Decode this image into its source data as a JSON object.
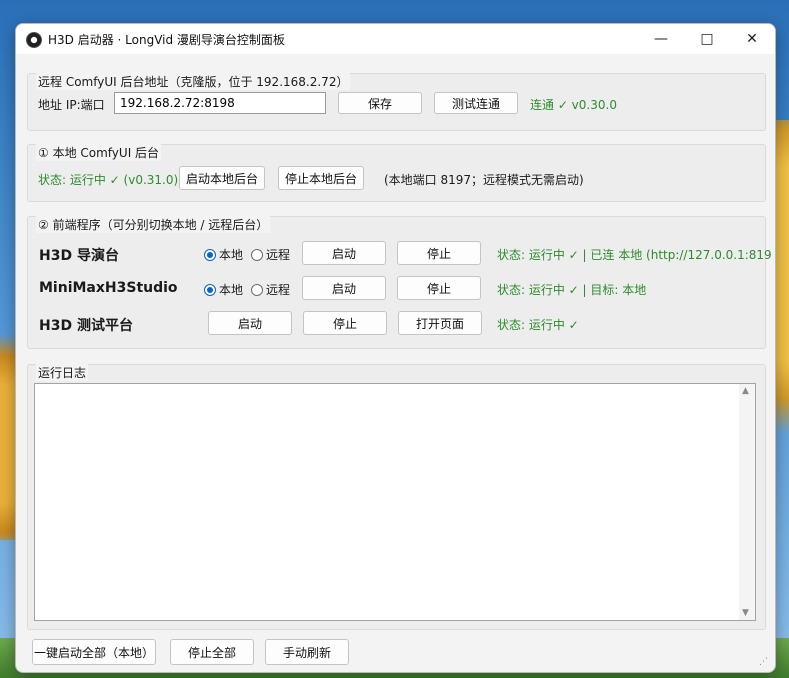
{
  "window": {
    "title": "H3D 启动器 · LongVid 漫剧导演台控制面板",
    "minimize_icon": "—",
    "maximize_icon": "□",
    "close_icon": "✕"
  },
  "remote": {
    "legend": "远程 ComfyUI 后台地址（克隆版，位于 192.168.2.72）",
    "address_label": "地址 IP:端口",
    "address_value": "192.168.2.72:8198",
    "save_label": "保存",
    "test_label": "测试连通",
    "status": "连通 ✓ v0.30.0"
  },
  "local": {
    "legend": "① 本地 ComfyUI 后台",
    "status": "状态: 运行中 ✓ (v0.31.0)",
    "start_label": "启动本地后台",
    "stop_label": "停止本地后台",
    "note": "(本地端口 8197；远程模式无需启动)"
  },
  "frontends": {
    "legend": "② 前端程序（可分别切换本地 / 远程后台）",
    "local_label": "本地",
    "remote_label": "远程",
    "items": [
      {
        "name": "H3D 导演台",
        "start": "启动",
        "stop": "停止",
        "status": "状态: 运行中 ✓ | 已连 本地 (http://127.0.0.1:819",
        "mode": "local"
      },
      {
        "name": "MiniMaxH3Studio",
        "start": "启动",
        "stop": "停止",
        "status": "状态: 运行中 ✓ | 目标: 本地",
        "mode": "local"
      },
      {
        "name": "H3D 测试平台",
        "start": "启动",
        "stop": "停止",
        "open": "打开页面",
        "status": "状态: 运行中 ✓"
      }
    ]
  },
  "log": {
    "legend": "运行日志",
    "scroll_up": "▲",
    "scroll_down": "▼"
  },
  "footer": {
    "start_all": "一键启动全部（本地）",
    "stop_all": "停止全部",
    "refresh": "手动刷新"
  },
  "colors": {
    "status_green": "#2e8b2e",
    "radio_accent": "#0a63c9"
  }
}
